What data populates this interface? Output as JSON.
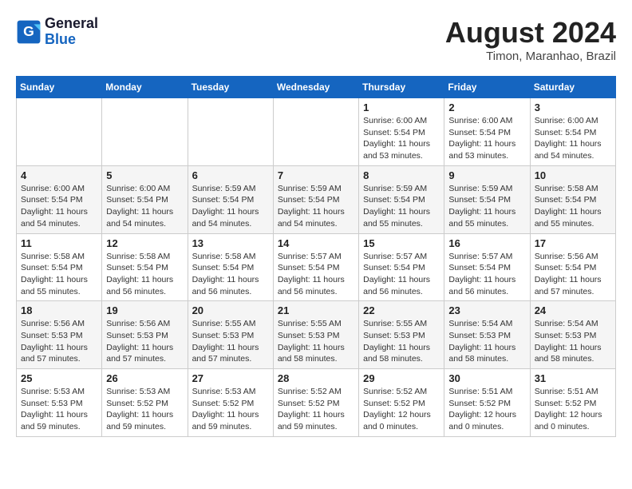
{
  "header": {
    "logo_line1": "General",
    "logo_line2": "Blue",
    "month_year": "August 2024",
    "location": "Timon, Maranhao, Brazil"
  },
  "weekdays": [
    "Sunday",
    "Monday",
    "Tuesday",
    "Wednesday",
    "Thursday",
    "Friday",
    "Saturday"
  ],
  "weeks": [
    [
      {
        "day": "",
        "info": ""
      },
      {
        "day": "",
        "info": ""
      },
      {
        "day": "",
        "info": ""
      },
      {
        "day": "",
        "info": ""
      },
      {
        "day": "1",
        "info": "Sunrise: 6:00 AM\nSunset: 5:54 PM\nDaylight: 11 hours\nand 53 minutes."
      },
      {
        "day": "2",
        "info": "Sunrise: 6:00 AM\nSunset: 5:54 PM\nDaylight: 11 hours\nand 53 minutes."
      },
      {
        "day": "3",
        "info": "Sunrise: 6:00 AM\nSunset: 5:54 PM\nDaylight: 11 hours\nand 54 minutes."
      }
    ],
    [
      {
        "day": "4",
        "info": "Sunrise: 6:00 AM\nSunset: 5:54 PM\nDaylight: 11 hours\nand 54 minutes."
      },
      {
        "day": "5",
        "info": "Sunrise: 6:00 AM\nSunset: 5:54 PM\nDaylight: 11 hours\nand 54 minutes."
      },
      {
        "day": "6",
        "info": "Sunrise: 5:59 AM\nSunset: 5:54 PM\nDaylight: 11 hours\nand 54 minutes."
      },
      {
        "day": "7",
        "info": "Sunrise: 5:59 AM\nSunset: 5:54 PM\nDaylight: 11 hours\nand 54 minutes."
      },
      {
        "day": "8",
        "info": "Sunrise: 5:59 AM\nSunset: 5:54 PM\nDaylight: 11 hours\nand 55 minutes."
      },
      {
        "day": "9",
        "info": "Sunrise: 5:59 AM\nSunset: 5:54 PM\nDaylight: 11 hours\nand 55 minutes."
      },
      {
        "day": "10",
        "info": "Sunrise: 5:58 AM\nSunset: 5:54 PM\nDaylight: 11 hours\nand 55 minutes."
      }
    ],
    [
      {
        "day": "11",
        "info": "Sunrise: 5:58 AM\nSunset: 5:54 PM\nDaylight: 11 hours\nand 55 minutes."
      },
      {
        "day": "12",
        "info": "Sunrise: 5:58 AM\nSunset: 5:54 PM\nDaylight: 11 hours\nand 56 minutes."
      },
      {
        "day": "13",
        "info": "Sunrise: 5:58 AM\nSunset: 5:54 PM\nDaylight: 11 hours\nand 56 minutes."
      },
      {
        "day": "14",
        "info": "Sunrise: 5:57 AM\nSunset: 5:54 PM\nDaylight: 11 hours\nand 56 minutes."
      },
      {
        "day": "15",
        "info": "Sunrise: 5:57 AM\nSunset: 5:54 PM\nDaylight: 11 hours\nand 56 minutes."
      },
      {
        "day": "16",
        "info": "Sunrise: 5:57 AM\nSunset: 5:54 PM\nDaylight: 11 hours\nand 56 minutes."
      },
      {
        "day": "17",
        "info": "Sunrise: 5:56 AM\nSunset: 5:54 PM\nDaylight: 11 hours\nand 57 minutes."
      }
    ],
    [
      {
        "day": "18",
        "info": "Sunrise: 5:56 AM\nSunset: 5:53 PM\nDaylight: 11 hours\nand 57 minutes."
      },
      {
        "day": "19",
        "info": "Sunrise: 5:56 AM\nSunset: 5:53 PM\nDaylight: 11 hours\nand 57 minutes."
      },
      {
        "day": "20",
        "info": "Sunrise: 5:55 AM\nSunset: 5:53 PM\nDaylight: 11 hours\nand 57 minutes."
      },
      {
        "day": "21",
        "info": "Sunrise: 5:55 AM\nSunset: 5:53 PM\nDaylight: 11 hours\nand 58 minutes."
      },
      {
        "day": "22",
        "info": "Sunrise: 5:55 AM\nSunset: 5:53 PM\nDaylight: 11 hours\nand 58 minutes."
      },
      {
        "day": "23",
        "info": "Sunrise: 5:54 AM\nSunset: 5:53 PM\nDaylight: 11 hours\nand 58 minutes."
      },
      {
        "day": "24",
        "info": "Sunrise: 5:54 AM\nSunset: 5:53 PM\nDaylight: 11 hours\nand 58 minutes."
      }
    ],
    [
      {
        "day": "25",
        "info": "Sunrise: 5:53 AM\nSunset: 5:53 PM\nDaylight: 11 hours\nand 59 minutes."
      },
      {
        "day": "26",
        "info": "Sunrise: 5:53 AM\nSunset: 5:52 PM\nDaylight: 11 hours\nand 59 minutes."
      },
      {
        "day": "27",
        "info": "Sunrise: 5:53 AM\nSunset: 5:52 PM\nDaylight: 11 hours\nand 59 minutes."
      },
      {
        "day": "28",
        "info": "Sunrise: 5:52 AM\nSunset: 5:52 PM\nDaylight: 11 hours\nand 59 minutes."
      },
      {
        "day": "29",
        "info": "Sunrise: 5:52 AM\nSunset: 5:52 PM\nDaylight: 12 hours\nand 0 minutes."
      },
      {
        "day": "30",
        "info": "Sunrise: 5:51 AM\nSunset: 5:52 PM\nDaylight: 12 hours\nand 0 minutes."
      },
      {
        "day": "31",
        "info": "Sunrise: 5:51 AM\nSunset: 5:52 PM\nDaylight: 12 hours\nand 0 minutes."
      }
    ]
  ]
}
